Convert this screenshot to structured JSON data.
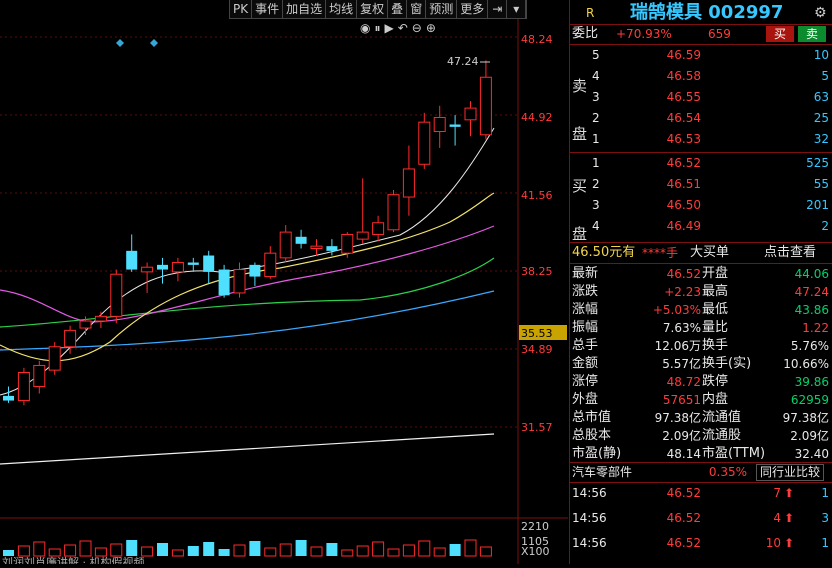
{
  "toolbar": {
    "items": [
      "PK",
      "事件",
      "加自选",
      "均线",
      "复权",
      "叠",
      "窗",
      "预测",
      "更多"
    ]
  },
  "chart": {
    "y_labels": {
      "p1": "48.24",
      "p2": "44.92",
      "p3": "41.56",
      "p4": "38.25",
      "p5": "34.89",
      "p6": "31.57",
      "highlight": "35.53"
    },
    "high_marker": "47.24",
    "vol_labels": {
      "v1": "2210",
      "v2": "1105",
      "unit": "X100"
    },
    "bottom_text": "刘润刘肖廉讲解 · 机构假视频"
  },
  "header": {
    "r_badge": "R",
    "title": "瑞鹄模具 002997"
  },
  "weibi": {
    "label": "委比",
    "pct": "+70.93%",
    "diff": "659",
    "buy": "买",
    "sell": "卖"
  },
  "sell_side": {
    "label": "卖盘",
    "rows": [
      {
        "lv": "5",
        "price": "46.59",
        "vol": "10"
      },
      {
        "lv": "4",
        "price": "46.58",
        "vol": "5"
      },
      {
        "lv": "3",
        "price": "46.55",
        "vol": "63"
      },
      {
        "lv": "2",
        "price": "46.54",
        "vol": "25"
      },
      {
        "lv": "1",
        "price": "46.53",
        "vol": "32"
      }
    ]
  },
  "buy_side": {
    "label": "买盘",
    "rows": [
      {
        "lv": "1",
        "price": "46.52",
        "vol": "525"
      },
      {
        "lv": "2",
        "price": "46.51",
        "vol": "55"
      },
      {
        "lv": "3",
        "price": "46.50",
        "vol": "201"
      },
      {
        "lv": "4",
        "price": "46.49",
        "vol": "2"
      }
    ]
  },
  "big_order": {
    "text": "46.50元有",
    "mask": "****手",
    "type": "大买单",
    "link": "点击查看"
  },
  "stats": [
    {
      "k1": "最新",
      "v1": "46.52",
      "c1": "red",
      "k2": "开盘",
      "v2": "44.06",
      "c2": "green"
    },
    {
      "k1": "涨跌",
      "v1": "+2.23",
      "c1": "red",
      "k2": "最高",
      "v2": "47.24",
      "c2": "red"
    },
    {
      "k1": "涨幅",
      "v1": "+5.03%",
      "c1": "red",
      "k2": "最低",
      "v2": "43.86",
      "c2": "green"
    },
    {
      "k1": "振幅",
      "v1": "7.63%",
      "c1": "white",
      "k2": "量比",
      "v2": "1.22",
      "c2": "red"
    },
    {
      "k1": "总手",
      "v1": "12.06万",
      "c1": "white",
      "k2": "换手",
      "v2": "5.76%",
      "c2": "white"
    },
    {
      "k1": "金额",
      "v1": "5.57亿",
      "c1": "white",
      "k2": "换手(实)",
      "v2": "10.66%",
      "c2": "white"
    },
    {
      "k1": "涨停",
      "v1": "48.72",
      "c1": "red",
      "k2": "跌停",
      "v2": "39.86",
      "c2": "green"
    },
    {
      "k1": "外盘",
      "v1": "57651",
      "c1": "red",
      "k2": "内盘",
      "v2": "62959",
      "c2": "green"
    },
    {
      "k1": "总市值",
      "v1": "97.38亿",
      "c1": "white",
      "k2": "流通值",
      "v2": "97.38亿",
      "c2": "white"
    },
    {
      "k1": "总股本",
      "v1": "2.09亿",
      "c1": "white",
      "k2": "流通股",
      "v2": "2.09亿",
      "c2": "white"
    },
    {
      "k1": "市盈(静)",
      "v1": "48.14",
      "c1": "white",
      "k2": "市盈(TTM)",
      "v2": "32.40",
      "c2": "white"
    }
  ],
  "industry": {
    "name": "汽车零部件",
    "pct": "0.35%",
    "compare": "同行业比较"
  },
  "ticks": [
    {
      "time": "14:56",
      "price": "46.52",
      "vol": "7",
      "n": "1"
    },
    {
      "time": "14:56",
      "price": "46.52",
      "vol": "4",
      "n": "3"
    },
    {
      "time": "14:56",
      "price": "46.52",
      "vol": "10",
      "n": "1"
    }
  ],
  "chart_data": {
    "type": "candlestick",
    "ylim": [
      31.57,
      48.24
    ],
    "ticks": [
      "48.24",
      "44.92",
      "41.56",
      "38.25",
      "34.89",
      "31.57"
    ],
    "candles": [
      {
        "o": 32.9,
        "h": 33.3,
        "l": 32.6,
        "c": 32.7
      },
      {
        "o": 32.7,
        "h": 34.1,
        "l": 32.5,
        "c": 33.9
      },
      {
        "o": 33.3,
        "h": 34.4,
        "l": 33.0,
        "c": 34.2
      },
      {
        "o": 34.0,
        "h": 35.2,
        "l": 33.8,
        "c": 35.0
      },
      {
        "o": 35.0,
        "h": 35.9,
        "l": 34.7,
        "c": 35.7
      },
      {
        "o": 35.8,
        "h": 36.3,
        "l": 35.5,
        "c": 36.1
      },
      {
        "o": 36.1,
        "h": 36.5,
        "l": 35.8,
        "c": 36.3
      },
      {
        "o": 36.3,
        "h": 38.3,
        "l": 36.0,
        "c": 38.1
      },
      {
        "o": 39.1,
        "h": 39.8,
        "l": 38.2,
        "c": 38.3
      },
      {
        "o": 38.2,
        "h": 38.6,
        "l": 37.3,
        "c": 38.4
      },
      {
        "o": 38.5,
        "h": 38.8,
        "l": 37.7,
        "c": 38.3
      },
      {
        "o": 38.2,
        "h": 38.8,
        "l": 37.8,
        "c": 38.6
      },
      {
        "o": 38.6,
        "h": 38.8,
        "l": 38.2,
        "c": 38.5
      },
      {
        "o": 38.9,
        "h": 39.1,
        "l": 37.7,
        "c": 38.2
      },
      {
        "o": 38.3,
        "h": 38.5,
        "l": 37.1,
        "c": 37.2
      },
      {
        "o": 37.3,
        "h": 38.6,
        "l": 37.1,
        "c": 38.3
      },
      {
        "o": 38.5,
        "h": 38.6,
        "l": 37.6,
        "c": 38.0
      },
      {
        "o": 38.0,
        "h": 39.3,
        "l": 37.9,
        "c": 39.0
      },
      {
        "o": 38.8,
        "h": 40.2,
        "l": 38.6,
        "c": 39.9
      },
      {
        "o": 39.7,
        "h": 40.0,
        "l": 39.2,
        "c": 39.4
      },
      {
        "o": 39.2,
        "h": 39.6,
        "l": 38.9,
        "c": 39.3
      },
      {
        "o": 39.3,
        "h": 39.6,
        "l": 38.9,
        "c": 39.1
      },
      {
        "o": 39.0,
        "h": 39.9,
        "l": 38.8,
        "c": 39.8
      },
      {
        "o": 39.6,
        "h": 42.2,
        "l": 39.4,
        "c": 39.9
      },
      {
        "o": 39.8,
        "h": 40.6,
        "l": 39.5,
        "c": 40.3
      },
      {
        "o": 40.0,
        "h": 41.7,
        "l": 39.9,
        "c": 41.5
      },
      {
        "o": 41.4,
        "h": 43.6,
        "l": 40.6,
        "c": 42.6
      },
      {
        "o": 42.8,
        "h": 45.0,
        "l": 42.6,
        "c": 44.6
      },
      {
        "o": 44.2,
        "h": 45.3,
        "l": 43.5,
        "c": 44.8
      },
      {
        "o": 44.5,
        "h": 44.9,
        "l": 43.6,
        "c": 44.4
      },
      {
        "o": 44.7,
        "h": 45.5,
        "l": 44.0,
        "c": 45.2
      },
      {
        "o": 44.06,
        "h": 47.24,
        "l": 43.86,
        "c": 46.52
      }
    ]
  }
}
